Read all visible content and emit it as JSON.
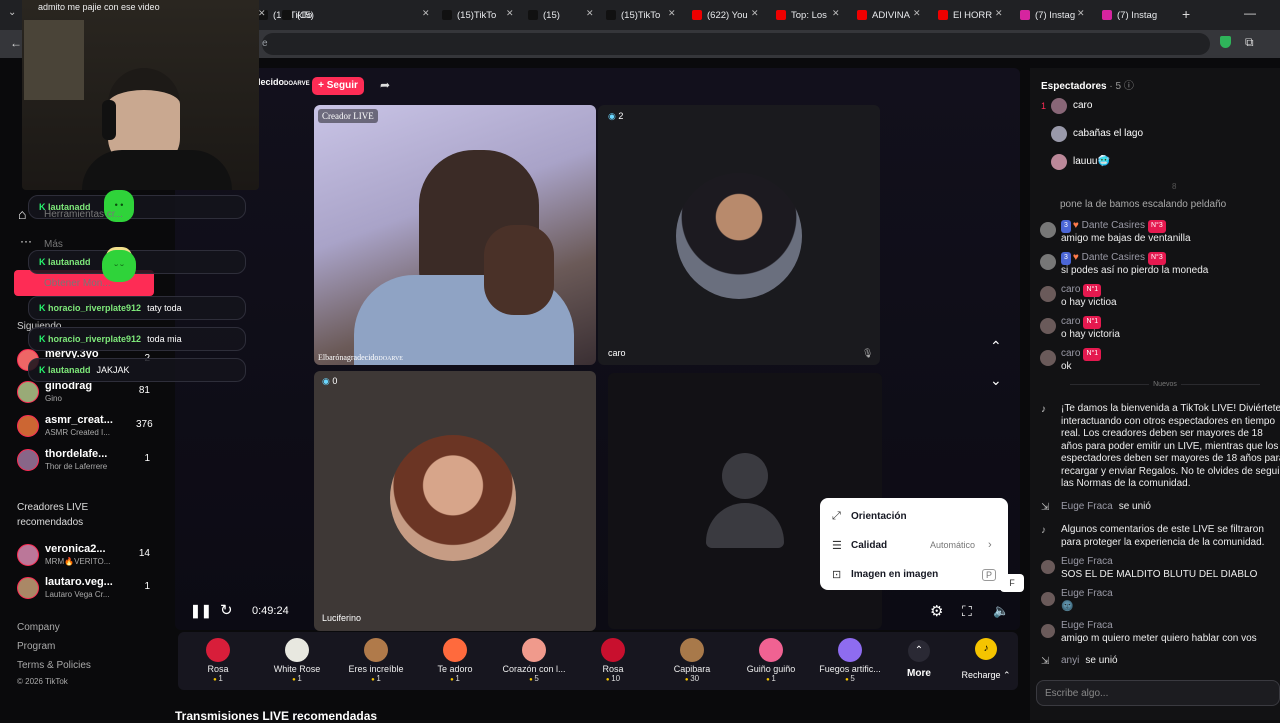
{
  "browser": {
    "tabs": [
      {
        "label": "(15)TikTo",
        "color": "#111"
      },
      {
        "label": "(15)",
        "color": "#111"
      },
      {
        "label": "(15)TikTo",
        "color": "#111"
      },
      {
        "label": "(15)",
        "color": "#111"
      },
      {
        "label": "(15)TikTo",
        "color": "#111"
      },
      {
        "label": "(622) You",
        "color": "#e00"
      },
      {
        "label": "Top: Los",
        "color": "#e00"
      },
      {
        "label": "ADIVINA",
        "color": "#e00"
      },
      {
        "label": "El HORR",
        "color": "#e00"
      },
      {
        "label": "(7) Instag",
        "color": "#d6249f"
      },
      {
        "label": "(7) Instag",
        "color": "#d6249f"
      }
    ],
    "new_tab": "+",
    "url_fragment": "e"
  },
  "webcam": {
    "caption": "admito me pajie con ese video"
  },
  "stream": {
    "host_name_fragment": "lecido",
    "host_badge": "DOARVE",
    "follow_label": "+ Seguir",
    "share_icon": "share-icon",
    "tiles": {
      "host": {
        "badge": "Creador LIVE",
        "name": "Elbarónagradecido",
        "name_suffix": "DOARVE"
      },
      "guest1": {
        "count": "2",
        "name": "caro"
      },
      "guest2": {
        "count": "0",
        "name": "Luciferino"
      }
    },
    "time": "0:49:24",
    "kbd_hint": "F"
  },
  "chat_overlay": [
    {
      "user": "lautanadd",
      "text": ""
    },
    {
      "user": "lautanadd",
      "text": ""
    },
    {
      "user": "horacio_riverplate912",
      "text": "taty toda"
    },
    {
      "user": "horacio_riverplate912",
      "text": "toda mia"
    },
    {
      "user": "lautanadd",
      "text": "JAKJAK"
    }
  ],
  "sidebar": {
    "behind": [
      "Herramientas cr...",
      "Más",
      "Obtener Mon..."
    ],
    "following_title": "Siguiendo",
    "following": [
      {
        "name": "mervy.3yo",
        "sub": "",
        "count": "2"
      },
      {
        "name": "ginodrag",
        "sub": "Gino",
        "count": "81"
      },
      {
        "name": "asmr_creat...",
        "sub": "ASMR Created I...",
        "count": "376"
      },
      {
        "name": "thordelafe...",
        "sub": "Thor de Laferrere",
        "count": "1"
      }
    ],
    "recommended_title": "Creadores LIVE recomendados",
    "recommended": [
      {
        "name": "veronica2...",
        "sub": "MRM🔥VERITO...",
        "count": "14"
      },
      {
        "name": "lautaro.veg...",
        "sub": "Lautaro Vega Cr...",
        "count": "1"
      }
    ],
    "footer": [
      "Company",
      "Program",
      "Terms & Policies",
      "© 2026 TikTok"
    ]
  },
  "popup": {
    "items": [
      {
        "label": "Orientación",
        "value": "",
        "icon": "orientation-icon"
      },
      {
        "label": "Calidad",
        "value": "Automático",
        "icon": "quality-icon"
      },
      {
        "label": "Imagen en imagen",
        "value": "P",
        "icon": "pip-icon"
      }
    ]
  },
  "gifts": [
    {
      "name": "Rosa",
      "price": "1",
      "color": "#d81e3a"
    },
    {
      "name": "White Rose",
      "price": "1",
      "color": "#e8e8e0"
    },
    {
      "name": "Eres increíble",
      "price": "1",
      "color": "#b07a4a"
    },
    {
      "name": "Te adoro",
      "price": "1",
      "color": "#ff6a3d"
    },
    {
      "name": "Corazón con l...",
      "price": "5",
      "color": "#f09a8c"
    },
    {
      "name": "Rosa",
      "price": "10",
      "color": "#c8102e"
    },
    {
      "name": "Capibara",
      "price": "30",
      "color": "#a8794a"
    },
    {
      "name": "Guiño guiño",
      "price": "1",
      "color": "#f06292"
    },
    {
      "name": "Fuegos artific...",
      "price": "5",
      "color": "#8e6cf0"
    }
  ],
  "more_label": "More",
  "recharge_label": "Recharge",
  "recommended_lives_title": "Transmisiones LIVE recomendadas",
  "viewers": {
    "title": "Espectadores",
    "count": "· 5",
    "list": [
      {
        "rank": "1",
        "name": "caro"
      },
      {
        "rank": "",
        "name": "cabañas el lago"
      },
      {
        "rank": "",
        "name": "lauuu🥶"
      }
    ],
    "more_marker": "8"
  },
  "comments": [
    {
      "name": "",
      "text": "pone la de bamos escalando peldaño",
      "level": ""
    },
    {
      "name": "Dante Casires",
      "text": "amigo me bajas de ventanilla",
      "level": "N°3",
      "badge": "3"
    },
    {
      "name": "Dante Casires",
      "text": "si podes así no pierdo la moneda",
      "level": "N°3",
      "badge": "3"
    },
    {
      "name": "caro",
      "text": "o hay victioa",
      "level": "N°1"
    },
    {
      "name": "caro",
      "text": "o hay victoria",
      "level": "N°1"
    },
    {
      "name": "caro",
      "text": "ok",
      "level": "N°1"
    }
  ],
  "new_divider": "Nuevos",
  "welcome": "¡Te damos la bienvenida a TikTok LIVE! Diviértete interactuando con otros espectadores en tiempo real. Los creadores deben ser mayores de 18 años para poder emitir un LIVE, mientras que los espectadores deben ser mayores de 18 años para recargar y enviar Regalos. No te olvides de seguir las Normas de la comunidad.",
  "new_events": [
    {
      "name": "Euge Fraca",
      "text": "se unió",
      "type": "join"
    },
    {
      "name": "",
      "text": "Algunos comentarios de este LIVE se filtraron para proteger la experiencia de la comunidad.",
      "type": "system"
    },
    {
      "name": "Euge Fraca",
      "text": "SOS EL DE MALDITO BLUTU DEL DIABLO",
      "type": "comment"
    },
    {
      "name": "Euge Fraca",
      "text": "🌚",
      "type": "comment"
    },
    {
      "name": "Euge Fraca",
      "text": "amigo m quiero meter quiero hablar con vos",
      "type": "comment"
    },
    {
      "name": "anyi",
      "text": "se unió",
      "type": "join"
    }
  ],
  "input_placeholder": "Escribe algo..."
}
